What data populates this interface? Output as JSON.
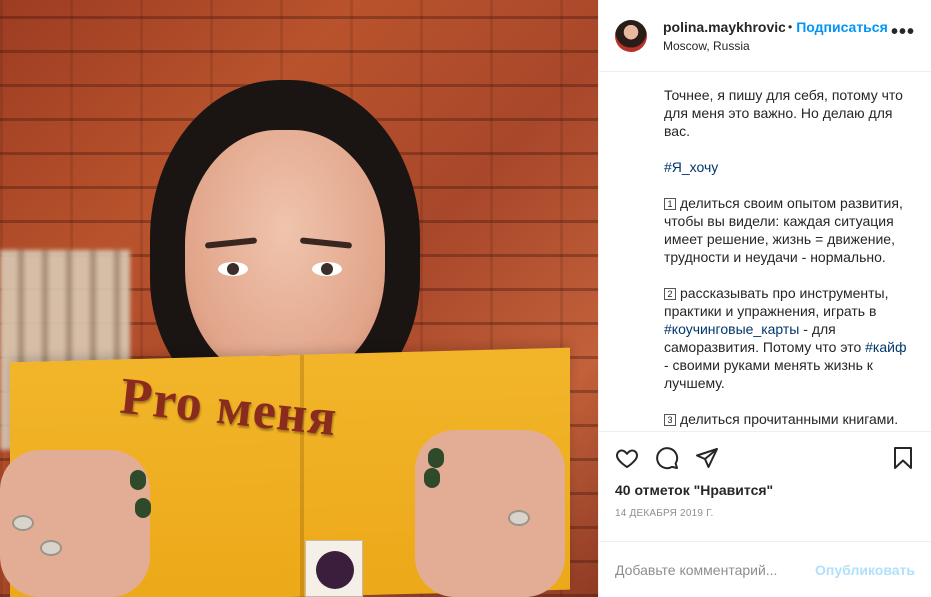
{
  "photo": {
    "book_title": "Pro меня"
  },
  "header": {
    "username": "polina.maykhrovich",
    "separator": "•",
    "follow_label": "Подписаться",
    "location": "Moscow, Russia",
    "more_label": "•••"
  },
  "caption": {
    "intro": "Точнее, я пишу для себя, потому что для меня это важно. Но делаю для вас.",
    "hashtag_main": "#Я_хочу",
    "item1_num": "1",
    "item1_text": "делиться своим опытом развития, чтобы вы видели: каждая ситуация имеет решение, жизнь = движение, трудности и неудачи - нормально.",
    "item2_num": "2",
    "item2_text_a": "рассказывать про инструменты, практики и упражнения, играть в",
    "item2_tag1": "#коучинговые_карты",
    "item2_text_b": "- для саморазвития. Потому что это",
    "item2_tag2": "#кайф",
    "item2_text_c": "- своими руками менять жизнь к лучшему.",
    "item3_num": "3",
    "item3_text": "делиться прочитанными книгами. Информации - океан! Порой, одна"
  },
  "actions": {
    "likes_text": "40 отметок \"Нравится\"",
    "date": "14 ДЕКАБРЯ 2019 Г."
  },
  "comment": {
    "placeholder": "Добавьте комментарий...",
    "publish_label": "Опубликовать"
  },
  "colors": {
    "link_blue": "#0095f6",
    "hashtag_blue": "#00376b",
    "publish_disabled": "#b2dffc",
    "book_yellow": "#eca919",
    "book_title_red": "#8a2b1d"
  }
}
